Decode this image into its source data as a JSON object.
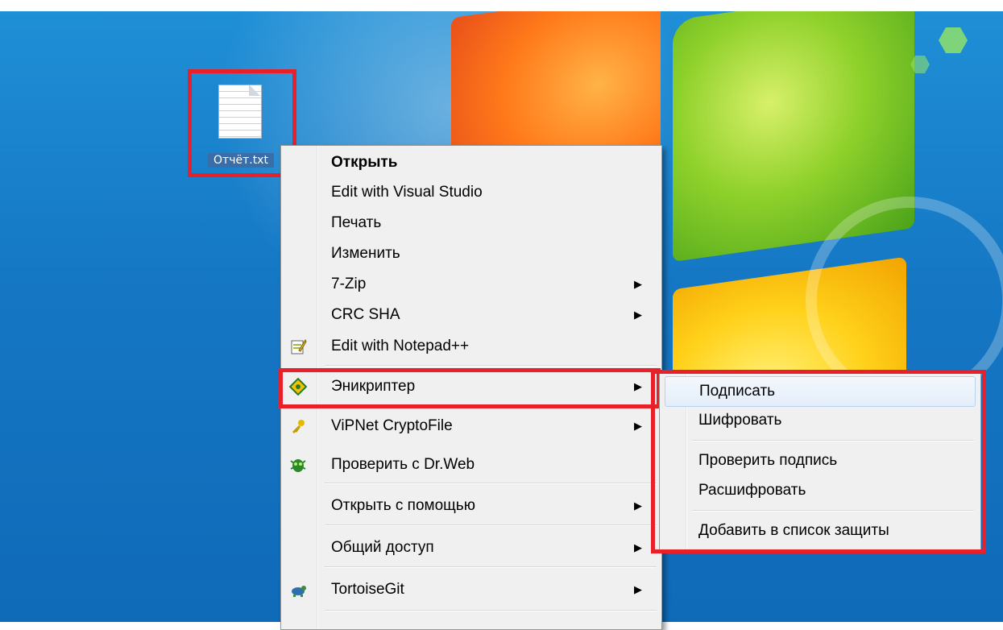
{
  "desktop": {
    "file_icon": {
      "label": "Отчёт.txt",
      "icon": "text-file-icon"
    }
  },
  "context_menu": {
    "items": [
      {
        "label": "Открыть",
        "bold": true,
        "submenu": false
      },
      {
        "label": "Edit with Visual Studio",
        "submenu": false
      },
      {
        "label": "Печать",
        "submenu": false
      },
      {
        "label": "Изменить",
        "submenu": false
      },
      {
        "label": "7-Zip",
        "submenu": true
      },
      {
        "label": "CRC SHA",
        "submenu": true
      },
      {
        "label": "Edit with Notepad++",
        "icon": "notepad-plus-plus-icon",
        "submenu": false
      },
      {
        "label": "Эникриптер",
        "icon": "enikripter-icon",
        "submenu": true
      },
      {
        "label": "ViPNet CryptoFile",
        "icon": "vipnet-key-icon",
        "submenu": true
      },
      {
        "label": "Проверить с Dr.Web",
        "icon": "drweb-spider-icon",
        "submenu": false
      },
      {
        "label": "Открыть с помощью",
        "submenu": true
      },
      {
        "label": "Общий доступ",
        "submenu": true
      },
      {
        "label": "TortoiseGit",
        "icon": "tortoisegit-icon",
        "submenu": true
      }
    ],
    "arrow": "▶"
  },
  "submenu": {
    "items": [
      {
        "label": "Подписать",
        "hovered": true
      },
      {
        "label": "Шифровать"
      },
      {
        "label": "Проверить подпись"
      },
      {
        "label": "Расшифровать"
      },
      {
        "label": "Добавить в список защиты"
      }
    ]
  },
  "colors": {
    "highlight_border": "#e8202a",
    "menu_bg": "#f0f0f0"
  }
}
